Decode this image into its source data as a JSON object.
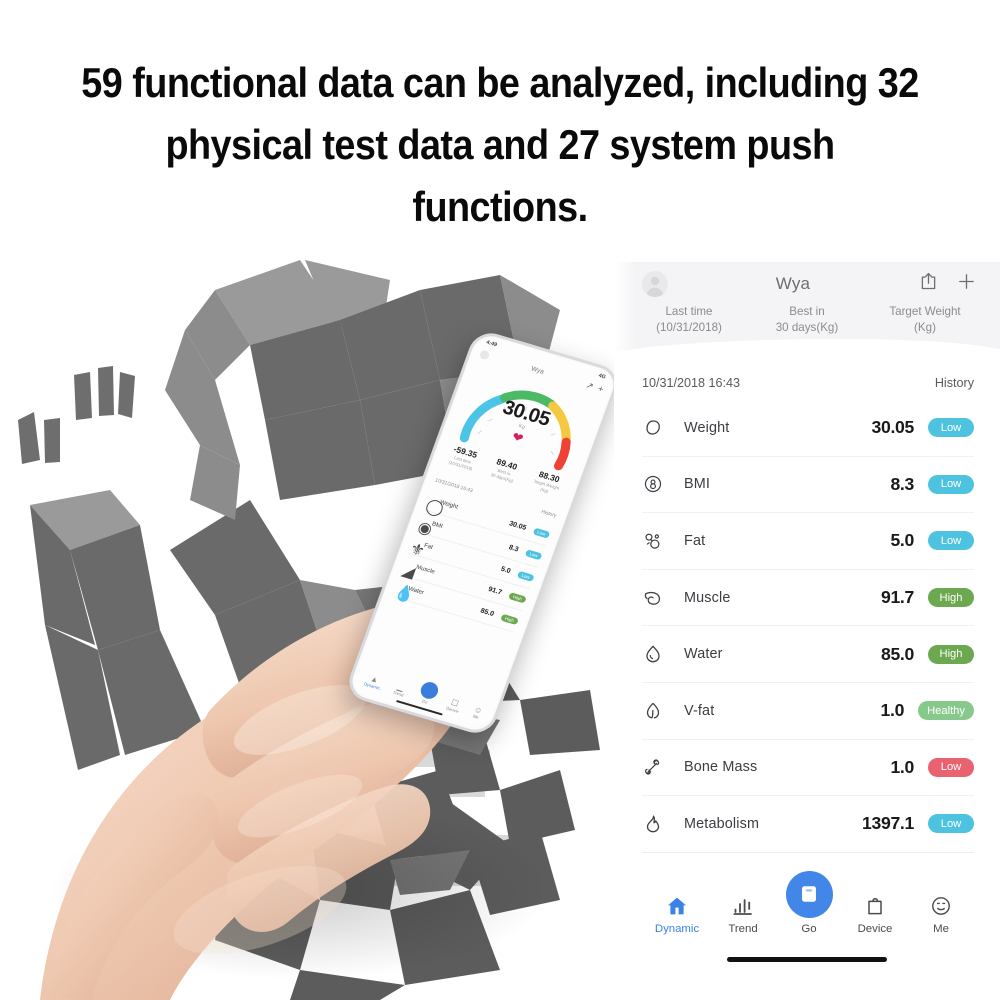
{
  "headline": "59 functional data can be analyzed, including 32 physical test data and 27 system push functions.",
  "colors": {
    "badge_low_blue": "#4ec3e0",
    "badge_high_green": "#6ba84f",
    "badge_healthy_green": "#86c98b",
    "badge_low_red": "#e8636f",
    "accent_blue": "#4286e8",
    "panel_header_bg": "#f4f4f6"
  },
  "app": {
    "header": {
      "avatar_icon": "person-avatar-icon",
      "title": "Wya",
      "share_icon": "share-icon",
      "add_icon": "plus-icon",
      "columns": [
        {
          "label": "Last time\n(10/31/2018)",
          "line1": "Last time",
          "line2": "(10/31/2018)"
        },
        {
          "label": "Best in 30 days(Kg)",
          "line1": "Best in",
          "line2": "30 days(Kg)"
        },
        {
          "label": "Target Weight (Kg)",
          "line1": "Target Weight",
          "line2": "(Kg)"
        }
      ]
    },
    "meta": {
      "timestamp": "10/31/2018 16:43",
      "history_label": "History"
    },
    "rows": [
      {
        "icon": "weight-scale-icon",
        "name": "Weight",
        "value": "30.05",
        "badge": "Low",
        "badge_color": "#4ec3e0"
      },
      {
        "icon": "bmi-icon",
        "name": "BMI",
        "value": "8.3",
        "badge": "Low",
        "badge_color": "#4ec3e0"
      },
      {
        "icon": "fat-cell-icon",
        "name": "Fat",
        "value": "5.0",
        "badge": "Low",
        "badge_color": "#4ec3e0"
      },
      {
        "icon": "muscle-arm-icon",
        "name": "Muscle",
        "value": "91.7",
        "badge": "High",
        "badge_color": "#6ba84f"
      },
      {
        "icon": "water-drop-icon",
        "name": "Water",
        "value": "85.0",
        "badge": "High",
        "badge_color": "#6ba84f"
      },
      {
        "icon": "visceral-fat-icon",
        "name": "V-fat",
        "value": "1.0",
        "badge": "Healthy",
        "badge_color": "#86c98b"
      },
      {
        "icon": "bone-icon",
        "name": "Bone Mass",
        "value": "1.0",
        "badge": "Low",
        "badge_color": "#e8636f"
      },
      {
        "icon": "flame-icon",
        "name": "Metabolism",
        "value": "1397.1",
        "badge": "Low",
        "badge_color": "#4ec3e0"
      }
    ],
    "bottom_nav": [
      {
        "icon": "home-icon",
        "label": "Dynamic",
        "active": true
      },
      {
        "icon": "chart-bar-icon",
        "label": "Trend",
        "active": false
      },
      {
        "icon": "scale-icon",
        "label": "Go",
        "active": false
      },
      {
        "icon": "device-icon",
        "label": "Device",
        "active": false
      },
      {
        "icon": "smiley-icon",
        "label": "Me",
        "active": false
      }
    ]
  },
  "phone": {
    "status_time": "4:49",
    "status_signal": "4G",
    "title": "Wya",
    "gauge_value": "30.05",
    "gauge_unit": "Kg",
    "gauge_min": "31",
    "gauge_max": "144",
    "stats": [
      {
        "value": "-59.35",
        "line1": "Last time",
        "line2": "(10/31/2018)"
      },
      {
        "value": "89.40",
        "line1": "Best in",
        "line2": "30 days(Kg)"
      },
      {
        "value": "88.30",
        "line1": "Target Weight",
        "line2": "(Kg)"
      }
    ],
    "meta_date": "10/31/2018 16:43",
    "meta_history": "History",
    "rows": [
      {
        "name": "Weight",
        "value": "30.05",
        "badge": "Low",
        "badge_color": "#4ec3e0"
      },
      {
        "name": "BMI",
        "value": "8.3",
        "badge": "Low",
        "badge_color": "#4ec3e0"
      },
      {
        "name": "Fat",
        "value": "5.0",
        "badge": "Low",
        "badge_color": "#4ec3e0"
      },
      {
        "name": "Muscle",
        "value": "91.7",
        "badge": "High",
        "badge_color": "#6ba84f"
      },
      {
        "name": "Water",
        "value": "85.0",
        "badge": "High",
        "badge_color": "#6ba84f"
      }
    ],
    "nav": [
      {
        "label": "Dynamic",
        "active": true
      },
      {
        "label": "Trend",
        "active": false
      },
      {
        "label": "Go",
        "active": false
      },
      {
        "label": "Device",
        "active": false
      },
      {
        "label": "Me",
        "active": false
      }
    ]
  }
}
